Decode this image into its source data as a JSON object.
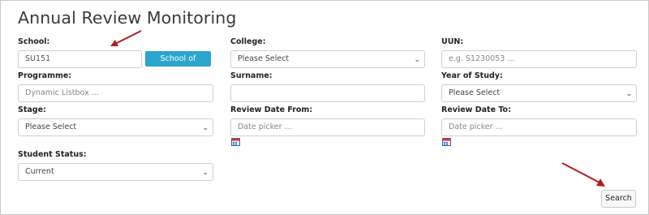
{
  "page": {
    "title": "Annual Review Monitoring"
  },
  "form": {
    "school": {
      "label": "School:",
      "value": "SU151",
      "badge": "School of Divinity"
    },
    "college": {
      "label": "College:",
      "value": "Please Select"
    },
    "uun": {
      "label": "UUN:",
      "placeholder": "e.g. S1230053 ..."
    },
    "programme": {
      "label": "Programme:",
      "placeholder": "Dynamic Listbox ..."
    },
    "surname": {
      "label": "Surname:",
      "value": ""
    },
    "year_of_study": {
      "label": "Year of Study:",
      "value": "Please Select"
    },
    "stage": {
      "label": "Stage:",
      "value": "Please Select"
    },
    "review_date_from": {
      "label": "Review Date From:",
      "placeholder": "Date picker ..."
    },
    "review_date_to": {
      "label": "Review Date To:",
      "placeholder": "Date picker ..."
    },
    "student_status": {
      "label": "Student Status:",
      "value": "Current"
    }
  },
  "actions": {
    "search_label": "Search"
  },
  "colors": {
    "badge": "#2aa5cf",
    "annotation_arrow": "#b01e1e"
  },
  "icons": {
    "select_chevron": "chevron-down-icon",
    "date_picker": "calendar-icon"
  }
}
